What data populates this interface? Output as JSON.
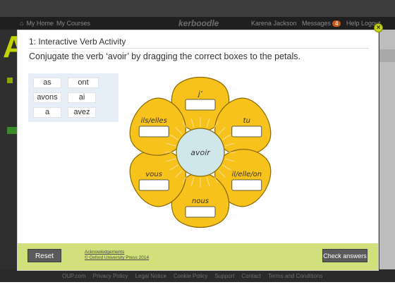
{
  "topbar": {
    "home": "My Home",
    "courses": "My Courses",
    "brand": "kerboodle",
    "user": "Karena Jackson",
    "messages": "Messages",
    "message_count": "4",
    "help": "Help",
    "logout": "Logout"
  },
  "background": {
    "letter": "A"
  },
  "modal": {
    "title": "1: Interactive Verb Activity",
    "instruction": "Conjugate the verb ‘avoir’ by dragging the correct boxes to the petals.",
    "close_symbol": "×"
  },
  "tiles": [
    "as",
    "ont",
    "avons",
    "ai",
    "a",
    "avez"
  ],
  "flower": {
    "center": "avoir",
    "petals": [
      "j’",
      "tu",
      "il/elle/on",
      "nous",
      "vous",
      "ils/elles"
    ]
  },
  "bottom": {
    "reset": "Reset",
    "acknowledgements": "Acknowledgements",
    "copyright": "© Oxford University Press 2014",
    "check": "Check answers"
  },
  "footer": {
    "links": [
      "OUP.com",
      "Privacy Policy",
      "Legal Notice",
      "Cookie Policy",
      "Support",
      "Contact",
      "Terms and Conditions"
    ]
  },
  "colors": {
    "petal": "#f7c21b",
    "petal_stroke": "#8a6a00",
    "center": "#cfe6ea",
    "accent": "#d1e07a"
  }
}
